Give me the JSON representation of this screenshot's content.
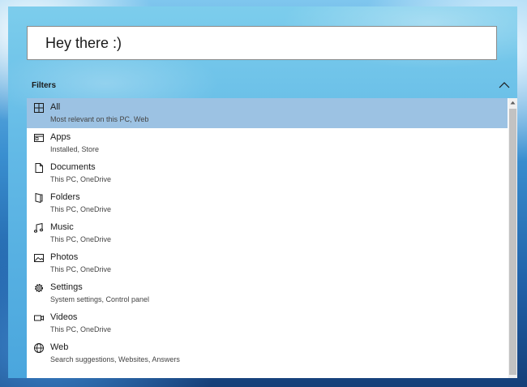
{
  "search": {
    "value": "Hey there :)"
  },
  "filters": {
    "label": "Filters",
    "items": [
      {
        "icon": "grid-icon",
        "title": "All",
        "subtitle": "Most relevant on this PC, Web",
        "selected": true
      },
      {
        "icon": "apps-icon",
        "title": "Apps",
        "subtitle": "Installed, Store"
      },
      {
        "icon": "document-icon",
        "title": "Documents",
        "subtitle": "This PC, OneDrive"
      },
      {
        "icon": "folder-icon",
        "title": "Folders",
        "subtitle": "This PC, OneDrive"
      },
      {
        "icon": "music-icon",
        "title": "Music",
        "subtitle": "This PC, OneDrive"
      },
      {
        "icon": "photo-icon",
        "title": "Photos",
        "subtitle": "This PC, OneDrive"
      },
      {
        "icon": "gear-icon",
        "title": "Settings",
        "subtitle": "System settings, Control panel"
      },
      {
        "icon": "video-icon",
        "title": "Videos",
        "subtitle": "This PC, OneDrive"
      },
      {
        "icon": "globe-icon",
        "title": "Web",
        "subtitle": "Search suggestions, Websites, Answers"
      }
    ]
  },
  "colors": {
    "selected": "#9cc2e3",
    "panel": "#62b9e6"
  }
}
